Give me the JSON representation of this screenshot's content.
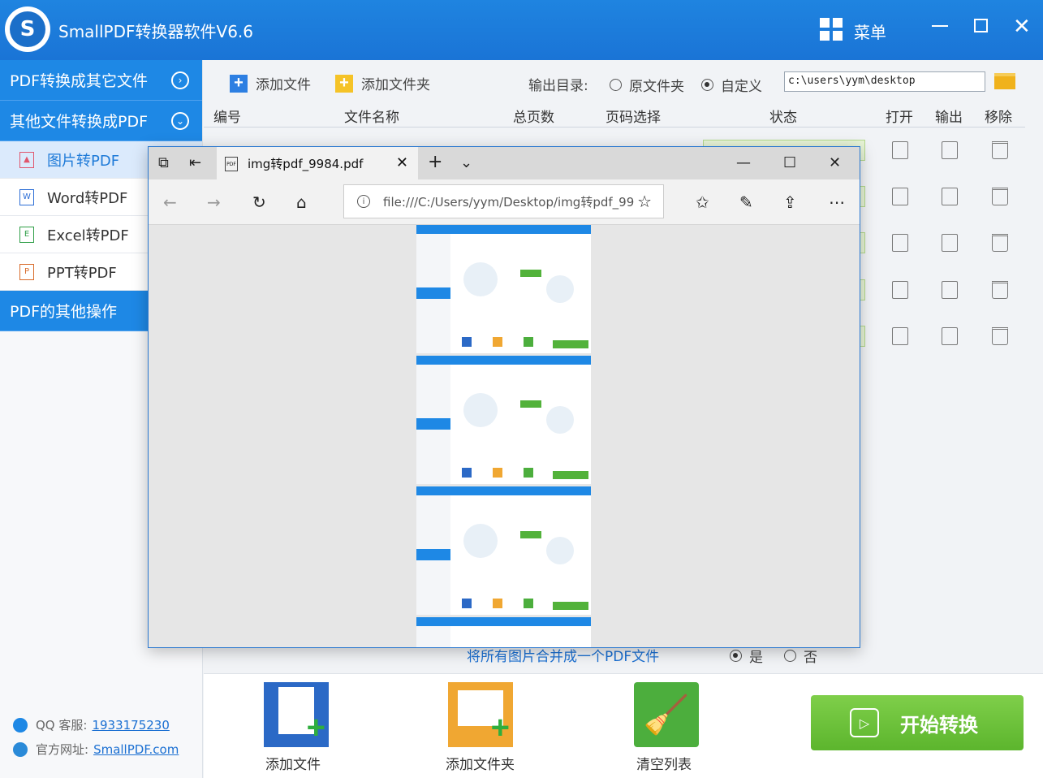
{
  "app": {
    "title": "SmallPDF转换器软件V6.6",
    "logo_letter": "S",
    "menu_label": "菜单",
    "brand_color": "#1e88e5"
  },
  "sidebar": {
    "section1": "PDF转换成其它文件",
    "section2": "其他文件转换成PDF",
    "items": [
      {
        "label": "图片转PDF",
        "icon": "image-file-icon",
        "active": true
      },
      {
        "label": "Word转PDF",
        "icon": "word-file-icon"
      },
      {
        "label": "Excel转PDF",
        "icon": "excel-file-icon"
      },
      {
        "label": "PPT转PDF",
        "icon": "ppt-file-icon"
      }
    ],
    "section3": "PDF的其他操作",
    "contact": {
      "qq_label": "QQ 客服:",
      "qq_value": "1933175230",
      "site_label": "官方网址:",
      "site_value": "SmallPDF.com"
    }
  },
  "toolbar": {
    "add_file": "添加文件",
    "add_folder": "添加文件夹",
    "output_label": "输出目录:",
    "radio_original": "原文件夹",
    "radio_custom": "自定义",
    "selected_radio": "自定义",
    "output_path": "c:\\users\\yym\\desktop"
  },
  "table": {
    "headers": [
      "编号",
      "文件名称",
      "总页数",
      "页码选择",
      "状态",
      "打开",
      "输出",
      "移除"
    ],
    "row_count": 5
  },
  "merge": {
    "label": "将所有图片合并成一个PDF文件",
    "yes": "是",
    "no": "否",
    "selected": "是"
  },
  "bottom": {
    "add_file": "添加文件",
    "add_folder": "添加文件夹",
    "clear_list": "清空列表",
    "start": "开始转换"
  },
  "browser": {
    "tab_title": "img转pdf_9984.pdf",
    "url": "file:///C:/Users/yym/Desktop/img转pdf_99",
    "pages_visible": 4
  }
}
